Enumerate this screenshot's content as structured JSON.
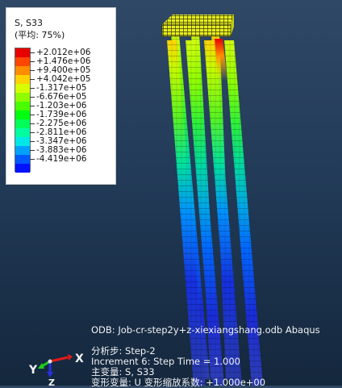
{
  "legend": {
    "variable": "S, S33",
    "averaging": "(平均: 75%)",
    "values": [
      "+2.012e+06",
      "+1.476e+06",
      "+9.400e+05",
      "+4.042e+05",
      "-1.317e+05",
      "-6.676e+05",
      "-1.203e+06",
      "-1.739e+06",
      "-2.275e+06",
      "-2.811e+06",
      "-3.347e+06",
      "-3.883e+06",
      "-4.419e+06"
    ],
    "colors": [
      "#e80000",
      "#ff4600",
      "#ff8d00",
      "#ffd200",
      "#d7fd00",
      "#8ffd00",
      "#48fd00",
      "#00fe10",
      "#00fe58",
      "#00fea0",
      "#00e7e8",
      "#00a1ff",
      "#0059ff",
      "#0012ff"
    ]
  },
  "info": {
    "odb": "ODB: Job-cr-step2y+z-xiexiangshang.odb    Abaqus",
    "step": "分析步: Step-2",
    "increment": "Increment      6: Step Time =      1.000",
    "primary_var": "主变量: S, S33",
    "deformed_var": "变形变量: U   变形缩放系数: +1.000e+00"
  },
  "triad": {
    "x": "X",
    "y": "Y",
    "z": "Z"
  },
  "colors": {
    "background_top": "#2f4866",
    "background_bottom": "#14273d",
    "cap": "#e8ef1a"
  }
}
